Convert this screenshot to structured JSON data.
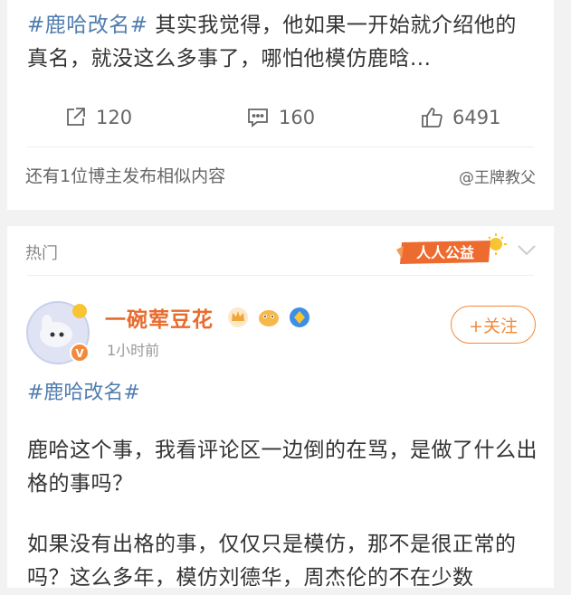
{
  "post1": {
    "topic": "#鹿哈改名#",
    "text": "其实我觉得，他如果一开始就介绍他的真名，就没这么多事了，哪怕他模仿鹿晗...",
    "repost_count": "120",
    "comment_count": "160",
    "like_count": "6491",
    "icons": {
      "repost": "share-icon",
      "comment": "comment-icon",
      "like": "thumbs-up-icon"
    }
  },
  "similar": {
    "text": "还有1位博主发布相似内容",
    "user": "@王牌教父"
  },
  "hot_section": {
    "label": "热门",
    "badge_text": "人人公益"
  },
  "post2": {
    "author": "一碗荤豆花",
    "time": "1小时前",
    "follow_label": "+关注",
    "topic": "#鹿哈改名#",
    "paragraph1": "鹿哈这个事，我看评论区一边倒的在骂，是做了什么出格的事吗？",
    "paragraph2": "如果没有出格的事，仅仅只是模仿，那不是很正常的吗？这么多年，模仿刘德华，周杰伦的不在少数"
  },
  "colors": {
    "topic": "#507daf",
    "author": "#e86c2e",
    "follow": "#f28a3c",
    "background": "#f2f2f2"
  }
}
